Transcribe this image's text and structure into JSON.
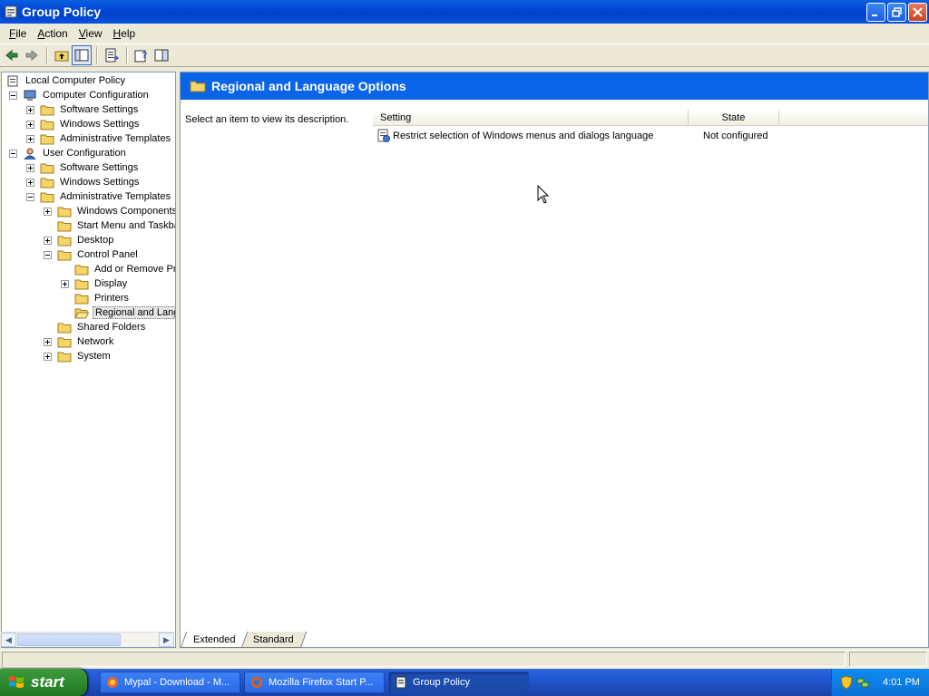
{
  "window": {
    "title": "Group Policy"
  },
  "menu": [
    {
      "key": "F",
      "rest": "ile"
    },
    {
      "key": "A",
      "rest": "ction"
    },
    {
      "key": "V",
      "rest": "iew"
    },
    {
      "key": "H",
      "rest": "elp"
    }
  ],
  "tree": [
    {
      "label": "Local Computer Policy",
      "level": 0,
      "expander": "none",
      "icon": "policy-icon"
    },
    {
      "label": "Computer Configuration",
      "level": 1,
      "expander": "minus",
      "icon": "computer-icon"
    },
    {
      "label": "Software Settings",
      "level": 2,
      "expander": "plus",
      "icon": "folder-icon"
    },
    {
      "label": "Windows Settings",
      "level": 2,
      "expander": "plus",
      "icon": "folder-icon"
    },
    {
      "label": "Administrative Templates",
      "level": 2,
      "expander": "plus",
      "icon": "folder-icon"
    },
    {
      "label": "User Configuration",
      "level": 1,
      "expander": "minus",
      "icon": "user-icon"
    },
    {
      "label": "Software Settings",
      "level": 2,
      "expander": "plus",
      "icon": "folder-icon"
    },
    {
      "label": "Windows Settings",
      "level": 2,
      "expander": "plus",
      "icon": "folder-icon"
    },
    {
      "label": "Administrative Templates",
      "level": 2,
      "expander": "minus",
      "icon": "folder-icon"
    },
    {
      "label": "Windows Components",
      "level": 3,
      "expander": "plus",
      "icon": "folder-icon"
    },
    {
      "label": "Start Menu and Taskbar",
      "level": 3,
      "expander": "none",
      "icon": "folder-icon"
    },
    {
      "label": "Desktop",
      "level": 3,
      "expander": "plus",
      "icon": "folder-icon"
    },
    {
      "label": "Control Panel",
      "level": 3,
      "expander": "minus",
      "icon": "folder-icon"
    },
    {
      "label": "Add or Remove Programs",
      "level": 4,
      "expander": "none",
      "icon": "folder-icon"
    },
    {
      "label": "Display",
      "level": 4,
      "expander": "plus",
      "icon": "folder-icon"
    },
    {
      "label": "Printers",
      "level": 4,
      "expander": "none",
      "icon": "folder-icon"
    },
    {
      "label": "Regional and Language Options",
      "level": 4,
      "expander": "none",
      "icon": "open-folder-icon",
      "selected": true
    },
    {
      "label": "Shared Folders",
      "level": 3,
      "expander": "none",
      "icon": "folder-icon"
    },
    {
      "label": "Network",
      "level": 3,
      "expander": "plus",
      "icon": "folder-icon"
    },
    {
      "label": "System",
      "level": 3,
      "expander": "plus",
      "icon": "folder-icon"
    }
  ],
  "details": {
    "header_title": "Regional and Language Options",
    "description": "Select an item to view its description.",
    "columns": {
      "setting": "Setting",
      "state": "State"
    },
    "rows": [
      {
        "setting": "Restrict selection of Windows menus and dialogs language",
        "state": "Not configured"
      }
    ]
  },
  "tabs": [
    {
      "label": "Extended",
      "active": true
    },
    {
      "label": "Standard",
      "active": false
    }
  ],
  "taskbar": {
    "start_label": "start",
    "buttons": [
      {
        "label": "Mypal - Download - M...",
        "icon": "mypal-icon",
        "active": false
      },
      {
        "label": "Mozilla Firefox Start P...",
        "icon": "firefox-icon",
        "active": false
      },
      {
        "label": "Group Policy",
        "icon": "group-policy-icon",
        "active": true
      }
    ],
    "clock": "4:01 PM"
  },
  "colors": {
    "accent": "#0a64e8",
    "titlebar": "#0047d6",
    "taskbar": "#245edb",
    "start": "#2f8a2f"
  }
}
